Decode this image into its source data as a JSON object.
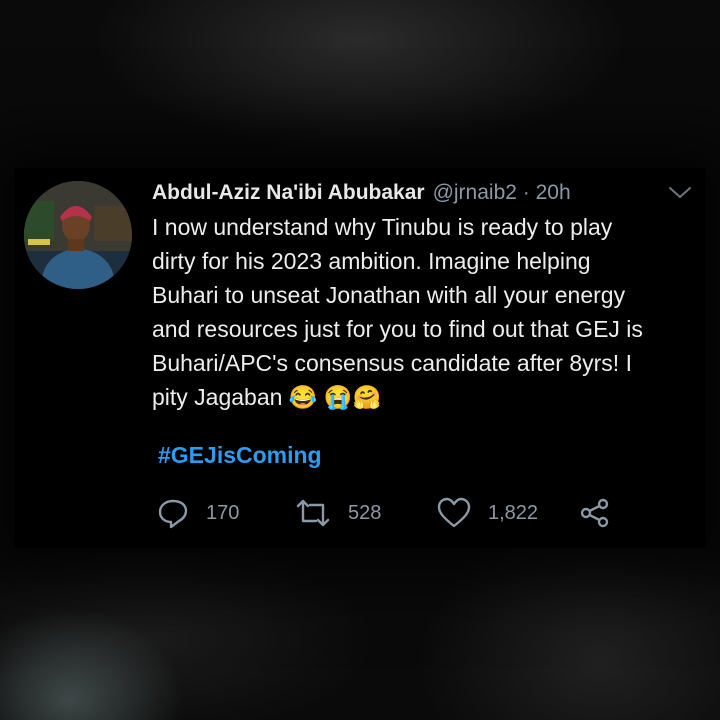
{
  "tweet": {
    "author_name": "Abdul-Aziz Na'ibi Abubakar",
    "handle_time": "@jrnaib2 · 20h",
    "text": "I now understand why Tinubu is ready to play\ndirty for his 2023 ambition. Imagine helping\nBuhari to unseat Jonathan with all your energy\nand resources just for you to find out that GEJ is\nBuhari/APC's consensus candidate after 8yrs! I\npity Jagaban 😂 😭🤗",
    "hashtag": "#GEJisComing",
    "replies": "170",
    "retweets": "528",
    "likes": "1,822"
  },
  "colors": {
    "background": "#000000",
    "text": "#ededed",
    "muted": "#8b98a5",
    "link": "#2d9cf0"
  },
  "icons": [
    "reply-icon",
    "retweet-icon",
    "like-icon",
    "share-icon",
    "chevron-down-icon"
  ]
}
